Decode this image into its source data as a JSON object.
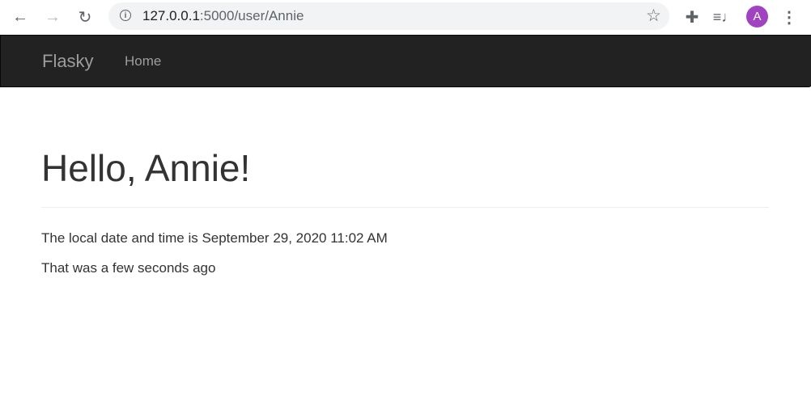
{
  "browser": {
    "url_host": "127.0.0.1",
    "url_rest": ":5000/user/Annie",
    "avatar_letter": "A",
    "avatar_color": "#a142c0"
  },
  "navbar": {
    "brand": "Flasky",
    "items": [
      {
        "label": "Home"
      }
    ]
  },
  "page": {
    "title": "Hello, Annie!",
    "datetime_text": "The local date and time is September 29, 2020 11:02 AM",
    "relative_text": "That was a few seconds ago"
  }
}
